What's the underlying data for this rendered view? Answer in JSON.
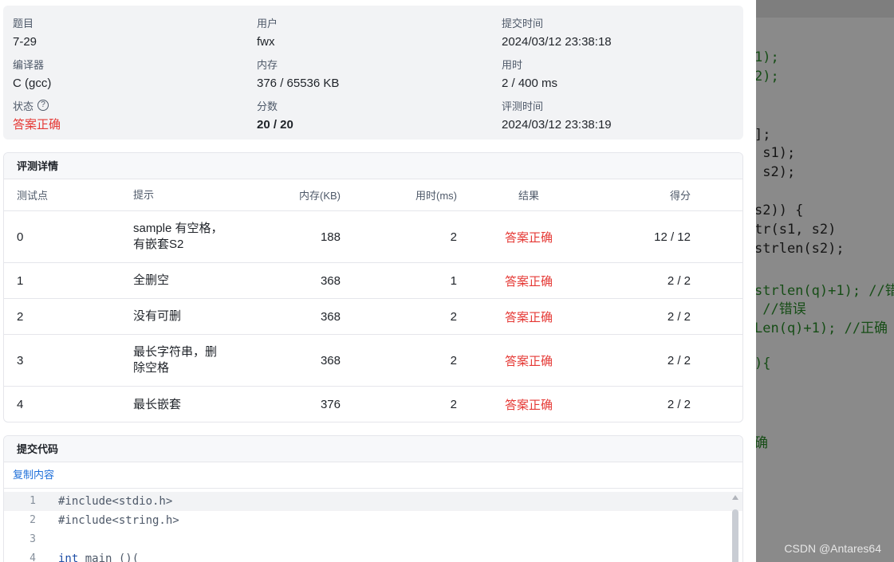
{
  "info": {
    "problem_label": "题目",
    "problem_value": "7-29",
    "user_label": "用户",
    "user_value": "fwx",
    "submit_time_label": "提交时间",
    "submit_time_value": "2024/03/12 23:38:18",
    "compiler_label": "编译器",
    "compiler_value": "C (gcc)",
    "memory_label": "内存",
    "memory_value": "376 / 65536 KB",
    "time_label": "用时",
    "time_value": "2 / 400 ms",
    "status_label": "状态",
    "status_help_icon": "?",
    "status_value": "答案正确",
    "score_label": "分数",
    "score_value": "20 / 20",
    "judge_time_label": "评测时间",
    "judge_time_value": "2024/03/12 23:38:19"
  },
  "details": {
    "title": "评测详情",
    "columns": {
      "case": "测试点",
      "hint": "提示",
      "memory": "内存(KB)",
      "time": "用时(ms)",
      "result": "结果",
      "score": "得分"
    },
    "rows": [
      {
        "case": "0",
        "hint_line1": "sample 有空格，",
        "hint_line2": "有嵌套S2",
        "memory": "188",
        "time": "2",
        "result": "答案正确",
        "score": "12 / 12"
      },
      {
        "case": "1",
        "hint_line1": "全删空",
        "hint_line2": "",
        "memory": "368",
        "time": "1",
        "result": "答案正确",
        "score": "2 / 2"
      },
      {
        "case": "2",
        "hint_line1": "没有可删",
        "hint_line2": "",
        "memory": "368",
        "time": "2",
        "result": "答案正确",
        "score": "2 / 2"
      },
      {
        "case": "3",
        "hint_line1": "最长字符串，删",
        "hint_line2": "除空格",
        "memory": "368",
        "time": "2",
        "result": "答案正确",
        "score": "2 / 2"
      },
      {
        "case": "4",
        "hint_line1": "最长嵌套",
        "hint_line2": "",
        "memory": "376",
        "time": "2",
        "result": "答案正确",
        "score": "2 / 2"
      }
    ]
  },
  "code": {
    "title": "提交代码",
    "copy_label": "复制内容",
    "lines": [
      {
        "no": "1",
        "text": "#include<stdio.h>"
      },
      {
        "no": "2",
        "text": "#include<string.h>"
      },
      {
        "no": "3",
        "text": ""
      },
      {
        "no": "4",
        "kw": "int",
        "text": " main ()("
      }
    ]
  },
  "overlay": {
    "lines": [
      "1);",
      "2);",
      "];",
      " s1);",
      " s2);",
      "s2)) {",
      "tr(s1, s2)",
      "strlen(s2);",
      "strlen(q)+1); //错",
      " //错误",
      "Len(q)+1); //正确",
      "){",
      "确"
    ],
    "watermark": "CSDN @Antares64"
  },
  "colors": {
    "accent": "#1e6fd9",
    "success_red": "#e53935",
    "panel_bg": "#f2f3f5"
  }
}
